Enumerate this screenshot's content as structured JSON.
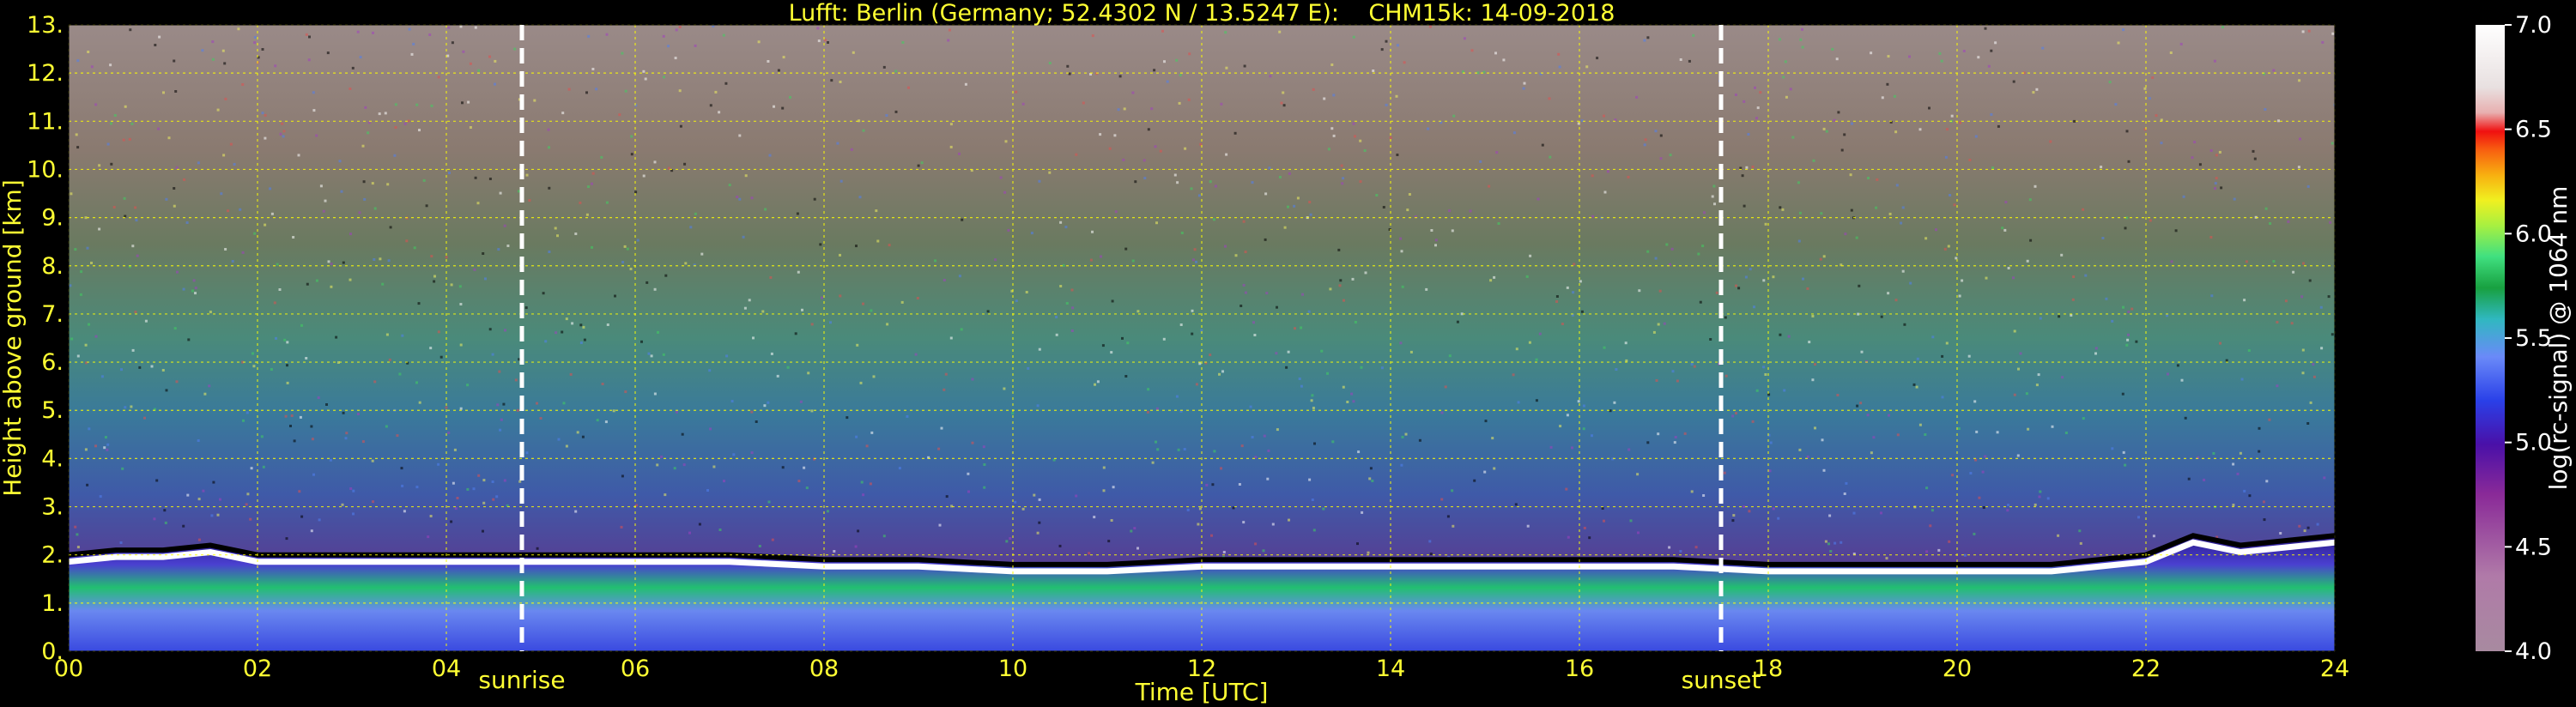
{
  "chart_data": {
    "type": "heatmap",
    "title": "Lufft: Berlin (Germany; 52.4302 N / 13.5247 E):    CHM15k: 14-09-2018",
    "xlabel": "Time [UTC]",
    "ylabel": "Height above ground [km]",
    "xlim": [
      0,
      24
    ],
    "ylim": [
      0,
      13
    ],
    "x_ticks": [
      "00",
      "02",
      "04",
      "06",
      "08",
      "10",
      "12",
      "14",
      "16",
      "18",
      "20",
      "22",
      "24"
    ],
    "y_ticks": [
      "0.",
      "1.",
      "2.",
      "3.",
      "4.",
      "5.",
      "6.",
      "7.",
      "8.",
      "9.",
      "10.",
      "11.",
      "12.",
      "13."
    ],
    "grid": true,
    "annotations": [
      {
        "label": "sunrise",
        "time_utc": 4.8
      },
      {
        "label": "sunset",
        "time_utc": 17.5
      }
    ],
    "colorbar": {
      "label": "log(rc-signal) @ 1064 nm",
      "range": [
        4.0,
        7.0
      ],
      "ticks": [
        "4.0",
        "4.5",
        "5.0",
        "5.5",
        "6.0",
        "6.5",
        "7.0"
      ]
    },
    "boundary_layer_top_km": [
      [
        0,
        2.0
      ],
      [
        0.5,
        2.1
      ],
      [
        1,
        2.1
      ],
      [
        1.5,
        2.2
      ],
      [
        2,
        2.0
      ],
      [
        3,
        2.0
      ],
      [
        4,
        2.0
      ],
      [
        5,
        2.0
      ],
      [
        6,
        2.0
      ],
      [
        7,
        2.0
      ],
      [
        8,
        1.9
      ],
      [
        9,
        1.9
      ],
      [
        10,
        1.8
      ],
      [
        11,
        1.8
      ],
      [
        12,
        1.9
      ],
      [
        13,
        1.9
      ],
      [
        14,
        1.9
      ],
      [
        15,
        1.9
      ],
      [
        16,
        1.9
      ],
      [
        17,
        1.9
      ],
      [
        18,
        1.8
      ],
      [
        19,
        1.8
      ],
      [
        20,
        1.8
      ],
      [
        21,
        1.8
      ],
      [
        22,
        2.0
      ],
      [
        22.5,
        2.4
      ],
      [
        23,
        2.2
      ],
      [
        23.5,
        2.3
      ],
      [
        24,
        2.4
      ]
    ],
    "colors": {
      "background": "#000000",
      "text": "#ffff33",
      "grid": "#ffff00",
      "marker": "#ffffff"
    }
  }
}
